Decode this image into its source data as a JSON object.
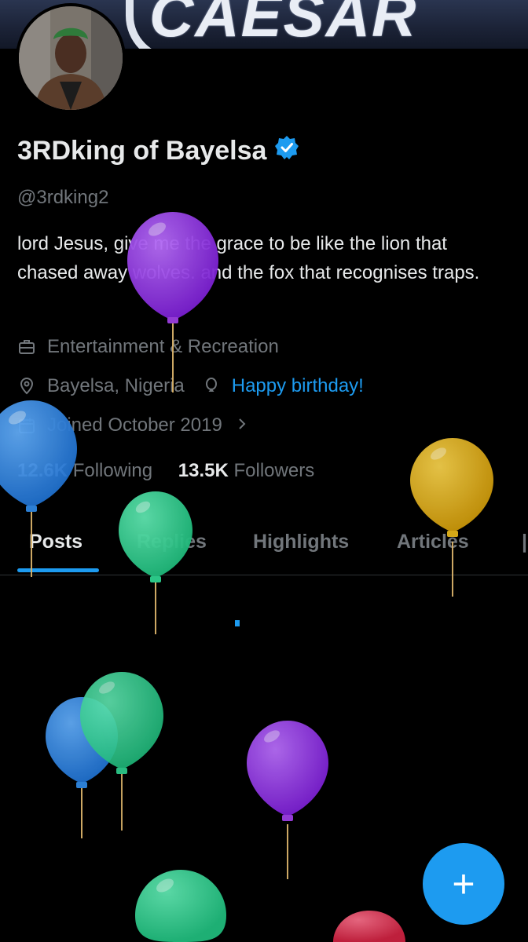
{
  "banner": {
    "text": "CAESAR"
  },
  "profile": {
    "display_name": "3RDking of Bayelsa",
    "handle": "@3rdking2",
    "bio": "lord Jesus, give me the grace to be like the lion that chased away wolves.  and the fox that recognises traps.",
    "category": "Entertainment & Recreation",
    "location": "Bayelsa, Nigeria",
    "birthday_link": "Happy birthday!",
    "joined": "Joined October 2019",
    "following_count": "12.6K",
    "following_label": "Following",
    "followers_count": "13.5K",
    "followers_label": "Followers",
    "verified_color": "#1d9bf0"
  },
  "tabs": [
    {
      "label": "Posts",
      "active": true
    },
    {
      "label": "Replies",
      "active": false
    },
    {
      "label": "Highlights",
      "active": false
    },
    {
      "label": "Articles",
      "active": false
    }
  ],
  "fab": {
    "label": "+"
  },
  "colors": {
    "accent": "#1d9bf0",
    "balloon_purple": "#8a2be2",
    "balloon_blue": "#2f86e0",
    "balloon_green": "#2ed18f",
    "balloon_yellow": "#e0b21a",
    "balloon_red": "#e0395a"
  }
}
